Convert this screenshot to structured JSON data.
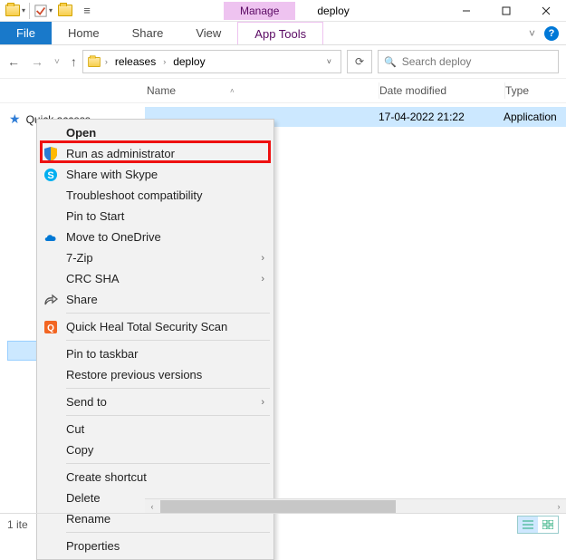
{
  "window": {
    "contextual_tab": "Manage",
    "title": "deploy",
    "controls": {
      "min": "—",
      "max": "☐",
      "close": "✕"
    }
  },
  "ribbon": {
    "file": "File",
    "tabs": [
      "Home",
      "Share",
      "View"
    ],
    "app_tools": "App Tools",
    "expand": "˅",
    "help": "?"
  },
  "nav": {
    "back": "←",
    "forward": "→",
    "down": "˅",
    "up": "↑",
    "crumbs": [
      "releases",
      "deploy"
    ],
    "refresh": "⟳"
  },
  "search": {
    "placeholder": "Search deploy",
    "icon": "🔍"
  },
  "columns": {
    "name": "Name",
    "date": "Date modified",
    "type": "Type"
  },
  "sidebar": {
    "quick_access": "Quick access"
  },
  "list": {
    "row": {
      "date": "17-04-2022 21:22",
      "type": "Application"
    }
  },
  "ctx": {
    "open": "Open",
    "run_admin": "Run as administrator",
    "skype": "Share with Skype",
    "troubleshoot": "Troubleshoot compatibility",
    "pin_start": "Pin to Start",
    "onedrive": "Move to OneDrive",
    "sevenzip": "7-Zip",
    "crc": "CRC SHA",
    "share": "Share",
    "qh": "Quick Heal Total Security Scan",
    "pin_tb": "Pin to taskbar",
    "restore": "Restore previous versions",
    "sendto": "Send to",
    "cut": "Cut",
    "copy": "Copy",
    "shortcut": "Create shortcut",
    "delete": "Delete",
    "rename": "Rename",
    "props": "Properties"
  },
  "status": {
    "text": "1 ite"
  }
}
